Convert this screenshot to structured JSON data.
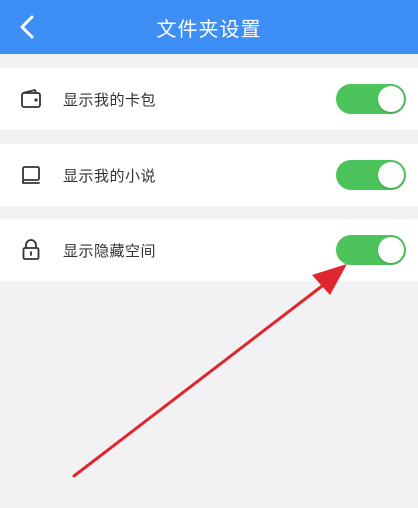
{
  "header": {
    "title": "文件夹设置",
    "back_icon": "chevron-left-icon",
    "background": "#3d8ef5"
  },
  "settings": [
    {
      "label": "显示我的卡包",
      "icon": "wallet-icon",
      "enabled": true
    },
    {
      "label": "显示我的小说",
      "icon": "book-icon",
      "enabled": true
    },
    {
      "label": "显示隐藏空间",
      "icon": "lock-icon",
      "enabled": true
    }
  ],
  "colors": {
    "toggle_on": "#4cc45b",
    "annotation_arrow": "#e0262d",
    "page_background": "#f2f2f5"
  }
}
